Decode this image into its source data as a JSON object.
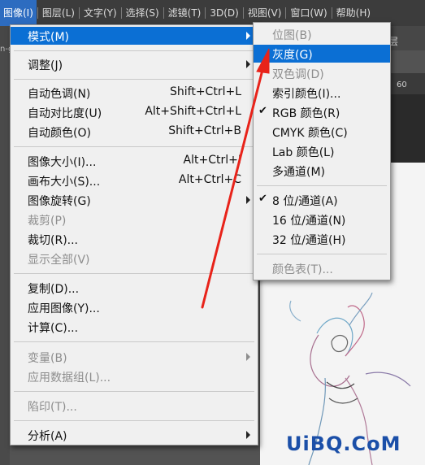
{
  "menubar": {
    "items": [
      {
        "label": "图像(I)"
      },
      {
        "label": "图层(L)"
      },
      {
        "label": "文字(Y)"
      },
      {
        "label": "选择(S)"
      },
      {
        "label": "滤镜(T)"
      },
      {
        "label": "3D(D)"
      },
      {
        "label": "视图(V)"
      },
      {
        "label": "窗口(W)"
      },
      {
        "label": "帮助(H)"
      }
    ]
  },
  "workspace": {
    "left_text": "n-g",
    "panel_text": "层",
    "ruler_value": "60"
  },
  "image_menu": {
    "mode": "模式(M)",
    "adjust": "调整(J)",
    "auto_tone": {
      "label": "自动色调(N)",
      "shortcut": "Shift+Ctrl+L"
    },
    "auto_contrast": {
      "label": "自动对比度(U)",
      "shortcut": "Alt+Shift+Ctrl+L"
    },
    "auto_color": {
      "label": "自动颜色(O)",
      "shortcut": "Shift+Ctrl+B"
    },
    "image_size": {
      "label": "图像大小(I)...",
      "shortcut": "Alt+Ctrl+I"
    },
    "canvas_size": {
      "label": "画布大小(S)...",
      "shortcut": "Alt+Ctrl+C"
    },
    "rotate": "图像旋转(G)",
    "crop": "裁剪(P)",
    "trim": "裁切(R)...",
    "reveal_all": "显示全部(V)",
    "duplicate": "复制(D)...",
    "apply_image": "应用图像(Y)...",
    "calculations": "计算(C)...",
    "variables": "变量(B)",
    "apply_dataset": "应用数据组(L)...",
    "trap": "陷印(T)...",
    "analysis": "分析(A)"
  },
  "mode_submenu": {
    "bitmap": "位图(B)",
    "grayscale": "灰度(G)",
    "duotone": "双色调(D)",
    "indexed": "索引颜色(I)...",
    "rgb": "RGB 颜色(R)",
    "cmyk": "CMYK 颜色(C)",
    "lab": "Lab 颜色(L)",
    "multichannel": "多通道(M)",
    "bit8": "8 位/通道(A)",
    "bit16": "16 位/通道(N)",
    "bit32": "32 位/通道(H)",
    "color_table": "颜色表(T)...",
    "check_glyph": "✔"
  },
  "watermark": "UiBQ.CoM",
  "colors": {
    "highlight": "#0b6fd4",
    "arrow": "#e8231a",
    "watermark": "#1b4fa8"
  }
}
